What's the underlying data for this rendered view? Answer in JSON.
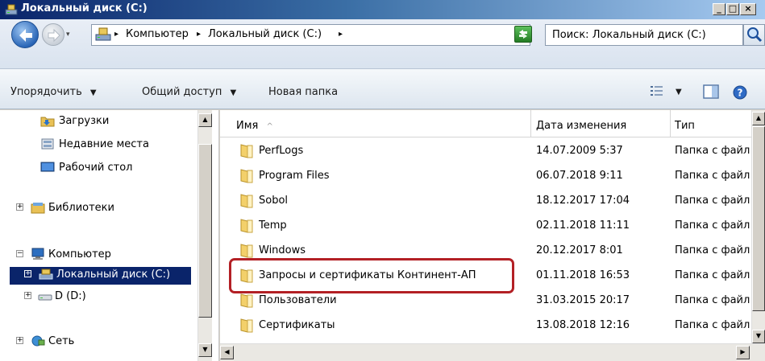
{
  "window": {
    "title": "Локальный диск (C:)",
    "minimize": "_",
    "maximize": "□",
    "close": "×"
  },
  "address": {
    "crumbs": [
      "Компьютер",
      "Локальный диск (C:)"
    ],
    "separator": "▸",
    "drop": "▾"
  },
  "search": {
    "placeholder": "Поиск: Локальный диск (C:)"
  },
  "toolbar": {
    "organize": "Упорядочить",
    "share": "Общий доступ",
    "new_folder": "Новая папка",
    "arrow": "▼"
  },
  "nav": {
    "items": [
      {
        "label": "Загрузки",
        "icon": "downloads-icon"
      },
      {
        "label": "Недавние места",
        "icon": "recent-places-icon"
      },
      {
        "label": "Рабочий стол",
        "icon": "desktop-icon"
      },
      {
        "label": "Библиотеки",
        "icon": "libraries-icon"
      },
      {
        "label": "Компьютер",
        "icon": "computer-icon"
      },
      {
        "label": "Локальный диск (C:)",
        "icon": "local-disk-icon"
      },
      {
        "label": "D (D:)",
        "icon": "drive-icon"
      },
      {
        "label": "Сеть",
        "icon": "network-icon"
      }
    ]
  },
  "columns": {
    "name": "Имя",
    "date": "Дата изменения",
    "type": "Тип",
    "sort_indicator": "^"
  },
  "rows": [
    {
      "name": "PerfLogs",
      "date": "14.07.2009 5:37",
      "type": "Папка с файл"
    },
    {
      "name": "Program Files",
      "date": "06.07.2018 9:11",
      "type": "Папка с файл"
    },
    {
      "name": "Sobol",
      "date": "18.12.2017 17:04",
      "type": "Папка с файл"
    },
    {
      "name": "Temp",
      "date": "02.11.2018 11:11",
      "type": "Папка с файл"
    },
    {
      "name": "Windows",
      "date": "20.12.2017 8:01",
      "type": "Папка с файл"
    },
    {
      "name": "Запросы и сертификаты Континент-АП",
      "date": "01.11.2018 16:53",
      "type": "Папка с файл"
    },
    {
      "name": "Пользователи",
      "date": "31.03.2015 20:17",
      "type": "Папка с файл"
    },
    {
      "name": "Сертификаты",
      "date": "13.08.2018 12:16",
      "type": "Папка с файл"
    }
  ],
  "highlight_color": "#b32025",
  "selection_color": "#0a246a"
}
